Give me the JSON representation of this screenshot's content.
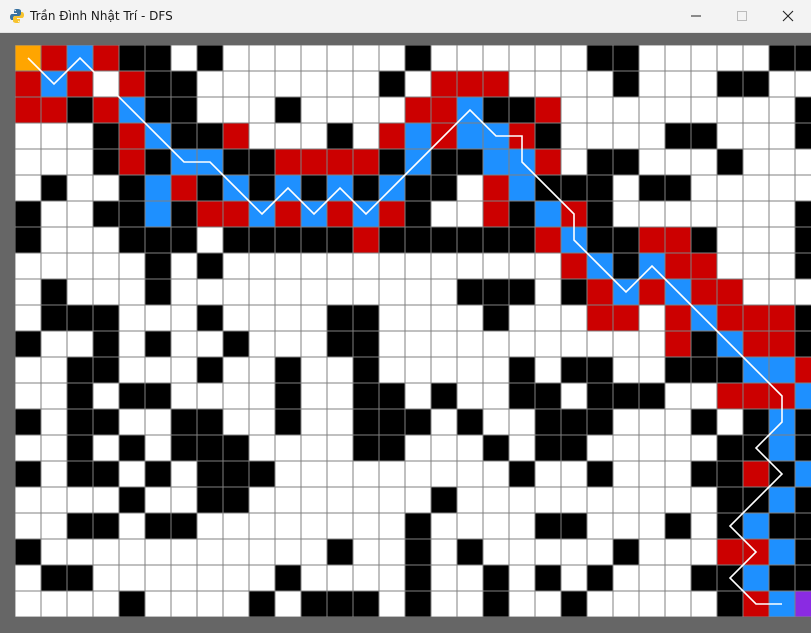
{
  "window": {
    "title": "Trần Đình Nhật Trí - DFS",
    "app_icon": "python-icon",
    "controls": [
      "minimize-icon",
      "maximize-icon",
      "close-icon"
    ]
  },
  "colors": {
    "wall": "#000000",
    "empty": "#ffffff",
    "visited": "#cc0000",
    "path": "#1e90ff",
    "start": "#ffa500",
    "goal": "#8a2be2",
    "grid_line": "#808080",
    "path_line": "#ffffff",
    "frame": "#666666"
  },
  "legend_codes": {
    "0": "empty",
    "1": "wall",
    "2": "visited",
    "3": "path",
    "4": "start",
    "5": "goal"
  },
  "grid": {
    "rows": 22,
    "cols": 30,
    "cells": [
      [
        4,
        2,
        3,
        2,
        1,
        1,
        0,
        1,
        0,
        0,
        0,
        0,
        0,
        0,
        0,
        1,
        0,
        0,
        0,
        0,
        0,
        0,
        1,
        1,
        0,
        0,
        0,
        0,
        0,
        1,
        1
      ],
      [
        2,
        3,
        2,
        0,
        2,
        1,
        1,
        0,
        0,
        0,
        0,
        0,
        0,
        0,
        1,
        0,
        2,
        2,
        2,
        0,
        0,
        0,
        0,
        1,
        0,
        0,
        0,
        1,
        1,
        0,
        0
      ],
      [
        2,
        2,
        1,
        2,
        3,
        1,
        1,
        0,
        0,
        0,
        1,
        0,
        0,
        0,
        0,
        2,
        2,
        3,
        1,
        1,
        2,
        0,
        0,
        0,
        0,
        0,
        0,
        0,
        0,
        0,
        1
      ],
      [
        0,
        0,
        0,
        1,
        2,
        3,
        1,
        1,
        2,
        0,
        0,
        0,
        1,
        0,
        2,
        3,
        2,
        3,
        3,
        2,
        1,
        0,
        0,
        0,
        0,
        1,
        1,
        0,
        0,
        0,
        1
      ],
      [
        0,
        0,
        0,
        1,
        2,
        1,
        3,
        3,
        1,
        1,
        2,
        2,
        2,
        2,
        1,
        3,
        1,
        1,
        3,
        3,
        2,
        0,
        1,
        1,
        0,
        0,
        0,
        1,
        0,
        0,
        0
      ],
      [
        0,
        1,
        0,
        0,
        1,
        3,
        2,
        1,
        3,
        1,
        3,
        1,
        3,
        1,
        3,
        1,
        1,
        0,
        2,
        3,
        1,
        1,
        1,
        0,
        1,
        1,
        0,
        0,
        0,
        0,
        0
      ],
      [
        1,
        0,
        0,
        1,
        1,
        3,
        1,
        2,
        2,
        3,
        2,
        3,
        2,
        3,
        2,
        1,
        0,
        0,
        2,
        1,
        3,
        2,
        1,
        0,
        0,
        0,
        0,
        0,
        0,
        0,
        1
      ],
      [
        1,
        0,
        0,
        0,
        1,
        1,
        1,
        0,
        1,
        1,
        1,
        1,
        1,
        2,
        1,
        1,
        1,
        1,
        1,
        1,
        2,
        3,
        1,
        1,
        2,
        2,
        1,
        0,
        0,
        0,
        1
      ],
      [
        0,
        0,
        0,
        0,
        0,
        1,
        0,
        1,
        0,
        0,
        0,
        0,
        0,
        0,
        0,
        0,
        0,
        0,
        0,
        0,
        0,
        2,
        3,
        1,
        3,
        2,
        2,
        0,
        0,
        0,
        1
      ],
      [
        0,
        1,
        0,
        0,
        0,
        1,
        0,
        0,
        0,
        0,
        0,
        0,
        0,
        0,
        0,
        0,
        0,
        1,
        1,
        1,
        0,
        1,
        2,
        3,
        2,
        3,
        2,
        2,
        0,
        0,
        0
      ],
      [
        0,
        1,
        1,
        1,
        0,
        0,
        0,
        1,
        0,
        0,
        0,
        0,
        1,
        1,
        0,
        0,
        0,
        0,
        1,
        0,
        0,
        0,
        2,
        2,
        0,
        2,
        3,
        2,
        2,
        2,
        1
      ],
      [
        1,
        0,
        0,
        1,
        0,
        1,
        0,
        0,
        1,
        0,
        0,
        0,
        1,
        1,
        0,
        0,
        0,
        0,
        0,
        0,
        0,
        0,
        0,
        0,
        0,
        2,
        1,
        3,
        2,
        2,
        1
      ],
      [
        0,
        0,
        1,
        1,
        0,
        0,
        0,
        1,
        0,
        0,
        1,
        0,
        0,
        1,
        0,
        0,
        0,
        0,
        0,
        1,
        0,
        1,
        1,
        0,
        0,
        1,
        1,
        1,
        3,
        3,
        2
      ],
      [
        0,
        0,
        1,
        0,
        1,
        1,
        0,
        0,
        0,
        0,
        1,
        0,
        0,
        1,
        1,
        0,
        1,
        0,
        0,
        1,
        1,
        0,
        1,
        1,
        1,
        0,
        0,
        2,
        2,
        2,
        3
      ],
      [
        1,
        0,
        1,
        1,
        0,
        0,
        1,
        1,
        0,
        0,
        1,
        0,
        0,
        1,
        1,
        1,
        0,
        1,
        0,
        0,
        1,
        1,
        1,
        0,
        0,
        0,
        1,
        0,
        1,
        3,
        1
      ],
      [
        0,
        0,
        1,
        0,
        1,
        0,
        1,
        1,
        1,
        0,
        0,
        0,
        0,
        1,
        1,
        0,
        0,
        0,
        1,
        0,
        1,
        1,
        0,
        0,
        0,
        0,
        0,
        1,
        1,
        3,
        1
      ],
      [
        1,
        0,
        1,
        1,
        0,
        1,
        0,
        1,
        1,
        1,
        0,
        0,
        0,
        0,
        0,
        0,
        0,
        0,
        0,
        1,
        0,
        0,
        1,
        0,
        0,
        0,
        1,
        1,
        2,
        1,
        3
      ],
      [
        0,
        0,
        0,
        0,
        1,
        0,
        0,
        1,
        1,
        0,
        0,
        0,
        0,
        0,
        0,
        0,
        1,
        0,
        0,
        0,
        0,
        0,
        0,
        0,
        0,
        0,
        0,
        1,
        1,
        3,
        1
      ],
      [
        0,
        0,
        1,
        1,
        0,
        1,
        1,
        0,
        0,
        0,
        0,
        0,
        0,
        0,
        0,
        1,
        0,
        0,
        0,
        0,
        1,
        1,
        0,
        0,
        0,
        1,
        0,
        1,
        3,
        1,
        1
      ],
      [
        1,
        0,
        0,
        0,
        0,
        0,
        0,
        0,
        0,
        0,
        0,
        0,
        1,
        0,
        0,
        1,
        0,
        1,
        0,
        0,
        0,
        0,
        0,
        1,
        0,
        0,
        0,
        2,
        2,
        3,
        1
      ],
      [
        0,
        1,
        1,
        0,
        0,
        0,
        0,
        0,
        0,
        0,
        1,
        0,
        0,
        0,
        0,
        1,
        0,
        0,
        1,
        0,
        1,
        0,
        1,
        0,
        0,
        0,
        1,
        1,
        3,
        1,
        1
      ],
      [
        0,
        0,
        0,
        0,
        1,
        0,
        0,
        0,
        0,
        1,
        0,
        1,
        1,
        1,
        0,
        1,
        0,
        0,
        1,
        0,
        0,
        1,
        0,
        0,
        0,
        0,
        0,
        1,
        2,
        3,
        5
      ]
    ]
  },
  "path": [
    [
      0,
      0
    ],
    [
      1,
      1
    ],
    [
      0,
      2
    ],
    [
      1,
      3
    ],
    [
      2,
      4
    ],
    [
      3,
      5
    ],
    [
      4,
      6
    ],
    [
      4,
      7
    ],
    [
      5,
      8
    ],
    [
      6,
      9
    ],
    [
      5,
      10
    ],
    [
      6,
      11
    ],
    [
      5,
      12
    ],
    [
      6,
      13
    ],
    [
      5,
      14
    ],
    [
      4,
      15
    ],
    [
      3,
      16
    ],
    [
      2,
      17
    ],
    [
      3,
      18
    ],
    [
      3,
      19
    ],
    [
      4,
      19
    ],
    [
      5,
      20
    ],
    [
      6,
      21
    ],
    [
      7,
      21
    ],
    [
      8,
      22
    ],
    [
      9,
      23
    ],
    [
      8,
      24
    ],
    [
      9,
      25
    ],
    [
      10,
      26
    ],
    [
      11,
      27
    ],
    [
      12,
      28
    ],
    [
      13,
      29
    ],
    [
      14,
      29
    ],
    [
      15,
      28
    ],
    [
      16,
      29
    ],
    [
      17,
      28
    ],
    [
      18,
      27
    ],
    [
      19,
      28
    ],
    [
      20,
      27
    ],
    [
      21,
      28
    ],
    [
      21,
      29
    ]
  ]
}
